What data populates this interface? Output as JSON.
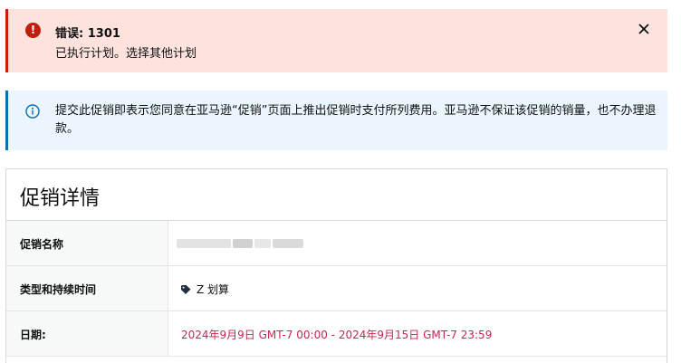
{
  "error_alert": {
    "title": "错误: 1301",
    "message": "已执行计划。选择其他计划",
    "close_symbol": "×"
  },
  "info_alert": {
    "message": "提交此促销即表示您同意在亚马逊“促销”页面上推出促销时支付所列费用。亚马逊不保证该促销的销量，也不办理退款。"
  },
  "panel": {
    "title": "促销详情",
    "rows": [
      {
        "label": "促销名称",
        "value": ""
      },
      {
        "label": "类型和持续时间",
        "value": "Z 划算",
        "icon": "tag-icon"
      },
      {
        "label": "日期:",
        "value": "2024年9月9日 GMT-7 00:00 - 2024年9月15日 GMT-7 23:59"
      }
    ]
  },
  "colors": {
    "error_bg": "#fde2de",
    "error_accent": "#cc1f00",
    "info_bg": "#eaf5fd",
    "info_accent": "#0a6fb0",
    "date_text": "#c7254e"
  }
}
